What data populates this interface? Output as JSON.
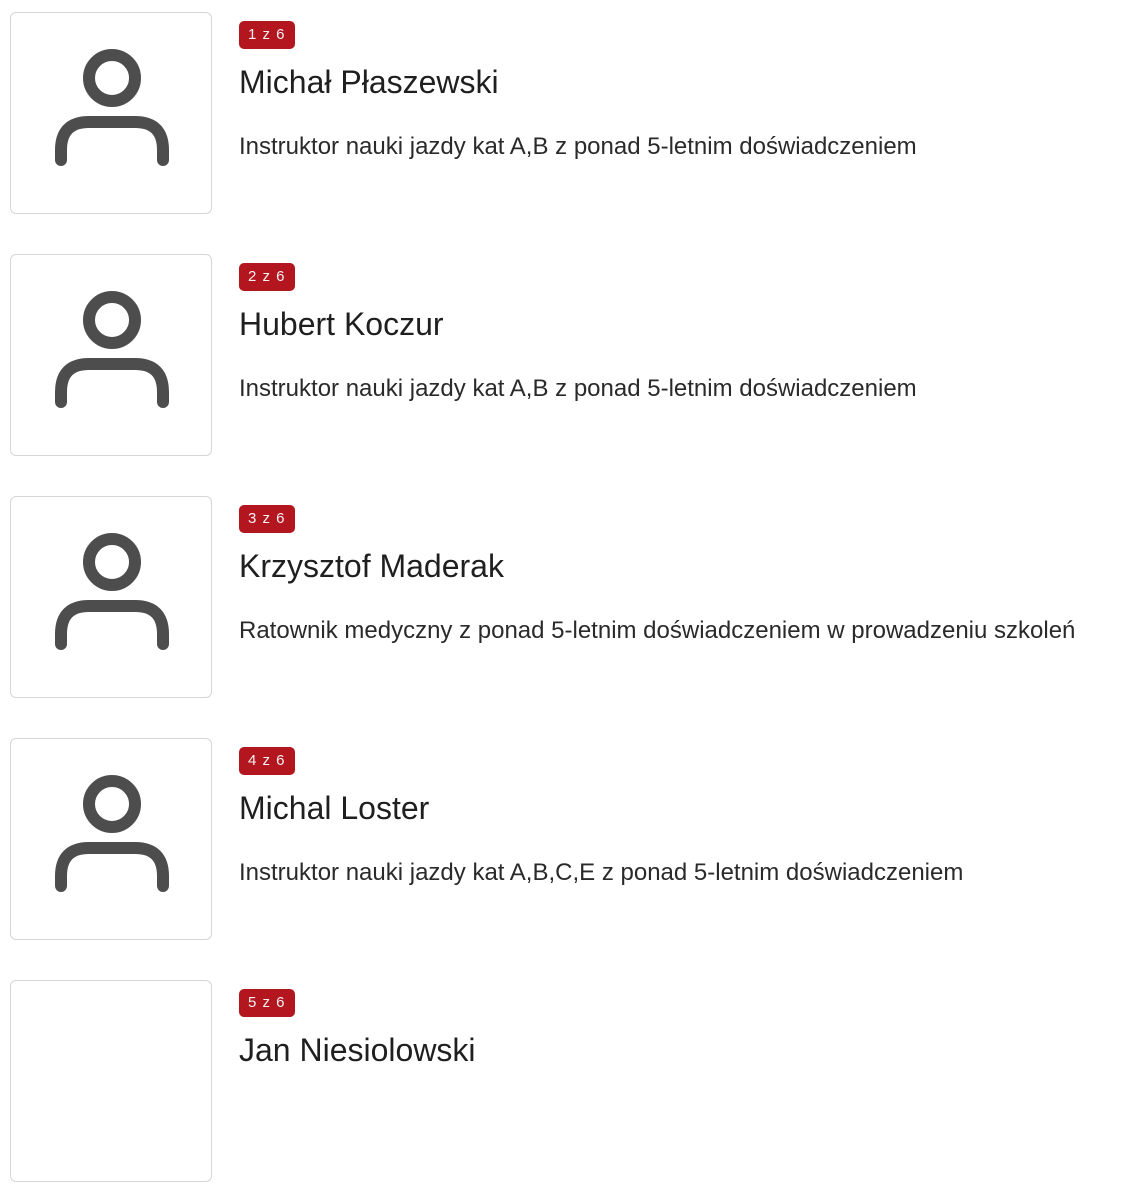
{
  "instructors": [
    {
      "badge": "1 z 6",
      "name": "Michał Płaszewski",
      "description": "Instruktor nauki jazdy kat A,B z ponad 5-letnim doświadczeniem",
      "avatar_icon": "user-icon"
    },
    {
      "badge": "2 z 6",
      "name": "Hubert Koczur",
      "description": "Instruktor nauki jazdy kat A,B z ponad 5-letnim doświadczeniem",
      "avatar_icon": "user-icon"
    },
    {
      "badge": "3 z 6",
      "name": "Krzysztof Maderak",
      "description": "Ratownik medyczny z ponad 5-letnim doświadczeniem w prowadzeniu szkoleń",
      "avatar_icon": "user-icon"
    },
    {
      "badge": "4 z 6",
      "name": "Michal Loster",
      "description": "Instruktor nauki jazdy kat A,B,C,E z ponad 5-letnim doświadczeniem",
      "avatar_icon": "user-icon"
    },
    {
      "badge": "5 z 6",
      "name": "Jan Niesiolowski",
      "description": "",
      "avatar_icon": ""
    }
  ],
  "colors": {
    "badge_background": "#b3161f",
    "badge_text": "#f3f3f3",
    "icon": "#4d4d4d",
    "avatar_border": "#d6d6d6"
  }
}
